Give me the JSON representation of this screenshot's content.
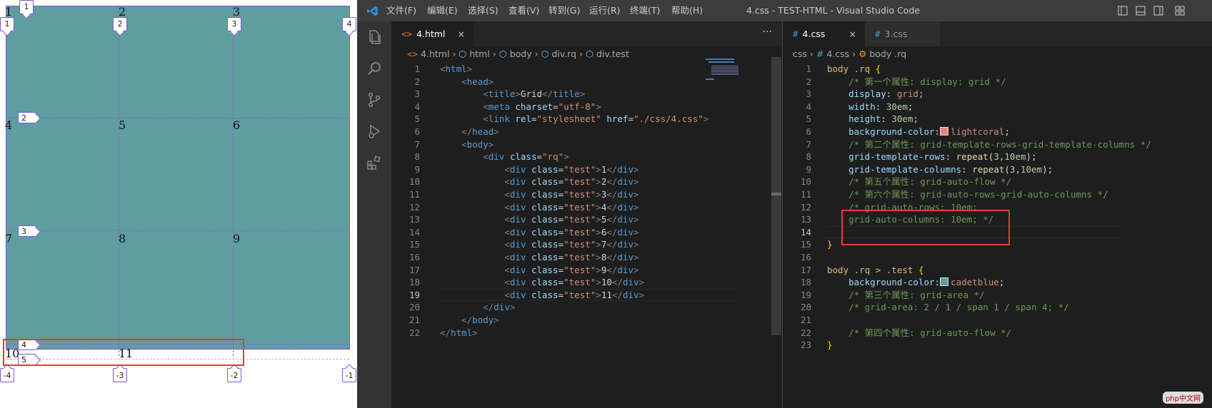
{
  "preview": {
    "cells": [
      "1",
      "2",
      "3",
      "4",
      "5",
      "6",
      "7",
      "8",
      "9",
      "10",
      "11"
    ],
    "line_tags_top": [
      "1",
      "2",
      "3",
      "4"
    ],
    "line_tags_left": [
      "1",
      "2",
      "3",
      "4",
      "5"
    ],
    "line_tags_bottom": [
      "-4",
      "-3",
      "-2",
      "-1"
    ],
    "colors": {
      "grid_bg": "#5f9ea0",
      "grid_lines": "#8a63d2",
      "highlight": "#e53935"
    }
  },
  "titlebar": {
    "menus": [
      "文件(F)",
      "编辑(E)",
      "选择(S)",
      "查看(V)",
      "转到(G)",
      "运行(R)",
      "终端(T)",
      "帮助(H)"
    ],
    "window_title": "4.css - TEST-HTML - Visual Studio Code"
  },
  "activity_icons": [
    "explorer-icon",
    "search-icon",
    "source-control-icon",
    "run-debug-icon",
    "extensions-icon"
  ],
  "left_editor": {
    "tab": {
      "label": "4.html",
      "icon": "<>",
      "close": "×"
    },
    "more": "···",
    "breadcrumb": [
      "4.html",
      "html",
      "body",
      "div.rq",
      "div.test"
    ],
    "current_line": 19,
    "lines": [
      [
        [
          "c-punc",
          "<"
        ],
        [
          "c-tag",
          "html"
        ],
        [
          "c-punc",
          ">"
        ]
      ],
      [
        [
          "c-text",
          "    "
        ],
        [
          "c-punc",
          "<"
        ],
        [
          "c-tag",
          "head"
        ],
        [
          "c-punc",
          ">"
        ]
      ],
      [
        [
          "c-text",
          "        "
        ],
        [
          "c-punc",
          "<"
        ],
        [
          "c-tag",
          "title"
        ],
        [
          "c-punc",
          ">"
        ],
        [
          "c-text",
          "Grid"
        ],
        [
          "c-punc",
          "</"
        ],
        [
          "c-tag",
          "title"
        ],
        [
          "c-punc",
          ">"
        ]
      ],
      [
        [
          "c-text",
          "        "
        ],
        [
          "c-punc",
          "<"
        ],
        [
          "c-tag",
          "meta"
        ],
        [
          "c-text",
          " "
        ],
        [
          "c-attr",
          "charset"
        ],
        [
          "c-text",
          "="
        ],
        [
          "c-str",
          "\"utf-8\""
        ],
        [
          "c-punc",
          ">"
        ]
      ],
      [
        [
          "c-text",
          "        "
        ],
        [
          "c-punc",
          "<"
        ],
        [
          "c-tag",
          "link"
        ],
        [
          "c-text",
          " "
        ],
        [
          "c-attr",
          "rel"
        ],
        [
          "c-text",
          "="
        ],
        [
          "c-str",
          "\"stylesheet\""
        ],
        [
          "c-text",
          " "
        ],
        [
          "c-attr",
          "href"
        ],
        [
          "c-text",
          "="
        ],
        [
          "c-str",
          "\"./css/4.css\""
        ],
        [
          "c-punc",
          ">"
        ]
      ],
      [
        [
          "c-text",
          "    "
        ],
        [
          "c-punc",
          "</"
        ],
        [
          "c-tag",
          "head"
        ],
        [
          "c-punc",
          ">"
        ]
      ],
      [
        [
          "c-text",
          "    "
        ],
        [
          "c-punc",
          "<"
        ],
        [
          "c-tag",
          "body"
        ],
        [
          "c-punc",
          ">"
        ]
      ],
      [
        [
          "c-text",
          "        "
        ],
        [
          "c-punc",
          "<"
        ],
        [
          "c-tag",
          "div"
        ],
        [
          "c-text",
          " "
        ],
        [
          "c-attr",
          "class"
        ],
        [
          "c-text",
          "="
        ],
        [
          "c-str",
          "\"rq\""
        ],
        [
          "c-punc",
          ">"
        ]
      ],
      [
        [
          "c-text",
          "            "
        ],
        [
          "c-punc",
          "<"
        ],
        [
          "c-tag",
          "div"
        ],
        [
          "c-text",
          " "
        ],
        [
          "c-attr",
          "class"
        ],
        [
          "c-text",
          "="
        ],
        [
          "c-str",
          "\"test\""
        ],
        [
          "c-punc",
          ">"
        ],
        [
          "c-text",
          "1"
        ],
        [
          "c-punc",
          "</"
        ],
        [
          "c-tag",
          "div"
        ],
        [
          "c-punc",
          ">"
        ]
      ],
      [
        [
          "c-text",
          "            "
        ],
        [
          "c-punc",
          "<"
        ],
        [
          "c-tag",
          "div"
        ],
        [
          "c-text",
          " "
        ],
        [
          "c-attr",
          "class"
        ],
        [
          "c-text",
          "="
        ],
        [
          "c-str",
          "\"test\""
        ],
        [
          "c-punc",
          ">"
        ],
        [
          "c-text",
          "2"
        ],
        [
          "c-punc",
          "</"
        ],
        [
          "c-tag",
          "div"
        ],
        [
          "c-punc",
          ">"
        ]
      ],
      [
        [
          "c-text",
          "            "
        ],
        [
          "c-punc",
          "<"
        ],
        [
          "c-tag",
          "div"
        ],
        [
          "c-text",
          " "
        ],
        [
          "c-attr",
          "class"
        ],
        [
          "c-text",
          "="
        ],
        [
          "c-str",
          "\"test\""
        ],
        [
          "c-punc",
          ">"
        ],
        [
          "c-text",
          "3"
        ],
        [
          "c-punc",
          "</"
        ],
        [
          "c-tag",
          "div"
        ],
        [
          "c-punc",
          ">"
        ]
      ],
      [
        [
          "c-text",
          "            "
        ],
        [
          "c-punc",
          "<"
        ],
        [
          "c-tag",
          "div"
        ],
        [
          "c-text",
          " "
        ],
        [
          "c-attr",
          "class"
        ],
        [
          "c-text",
          "="
        ],
        [
          "c-str",
          "\"test\""
        ],
        [
          "c-punc",
          ">"
        ],
        [
          "c-text",
          "4"
        ],
        [
          "c-punc",
          "</"
        ],
        [
          "c-tag",
          "div"
        ],
        [
          "c-punc",
          ">"
        ]
      ],
      [
        [
          "c-text",
          "            "
        ],
        [
          "c-punc",
          "<"
        ],
        [
          "c-tag",
          "div"
        ],
        [
          "c-text",
          " "
        ],
        [
          "c-attr",
          "class"
        ],
        [
          "c-text",
          "="
        ],
        [
          "c-str",
          "\"test\""
        ],
        [
          "c-punc",
          ">"
        ],
        [
          "c-text",
          "5"
        ],
        [
          "c-punc",
          "</"
        ],
        [
          "c-tag",
          "div"
        ],
        [
          "c-punc",
          ">"
        ]
      ],
      [
        [
          "c-text",
          "            "
        ],
        [
          "c-punc",
          "<"
        ],
        [
          "c-tag",
          "div"
        ],
        [
          "c-text",
          " "
        ],
        [
          "c-attr",
          "class"
        ],
        [
          "c-text",
          "="
        ],
        [
          "c-str",
          "\"test\""
        ],
        [
          "c-punc",
          ">"
        ],
        [
          "c-text",
          "6"
        ],
        [
          "c-punc",
          "</"
        ],
        [
          "c-tag",
          "div"
        ],
        [
          "c-punc",
          ">"
        ]
      ],
      [
        [
          "c-text",
          "            "
        ],
        [
          "c-punc",
          "<"
        ],
        [
          "c-tag",
          "div"
        ],
        [
          "c-text",
          " "
        ],
        [
          "c-attr",
          "class"
        ],
        [
          "c-text",
          "="
        ],
        [
          "c-str",
          "\"test\""
        ],
        [
          "c-punc",
          ">"
        ],
        [
          "c-text",
          "7"
        ],
        [
          "c-punc",
          "</"
        ],
        [
          "c-tag",
          "div"
        ],
        [
          "c-punc",
          ">"
        ]
      ],
      [
        [
          "c-text",
          "            "
        ],
        [
          "c-punc",
          "<"
        ],
        [
          "c-tag",
          "div"
        ],
        [
          "c-text",
          " "
        ],
        [
          "c-attr",
          "class"
        ],
        [
          "c-text",
          "="
        ],
        [
          "c-str",
          "\"test\""
        ],
        [
          "c-punc",
          ">"
        ],
        [
          "c-text",
          "8"
        ],
        [
          "c-punc",
          "</"
        ],
        [
          "c-tag",
          "div"
        ],
        [
          "c-punc",
          ">"
        ]
      ],
      [
        [
          "c-text",
          "            "
        ],
        [
          "c-punc",
          "<"
        ],
        [
          "c-tag",
          "div"
        ],
        [
          "c-text",
          " "
        ],
        [
          "c-attr",
          "class"
        ],
        [
          "c-text",
          "="
        ],
        [
          "c-str",
          "\"test\""
        ],
        [
          "c-punc",
          ">"
        ],
        [
          "c-text",
          "9"
        ],
        [
          "c-punc",
          "</"
        ],
        [
          "c-tag",
          "div"
        ],
        [
          "c-punc",
          ">"
        ]
      ],
      [
        [
          "c-text",
          "            "
        ],
        [
          "c-punc",
          "<"
        ],
        [
          "c-tag",
          "div"
        ],
        [
          "c-text",
          " "
        ],
        [
          "c-attr",
          "class"
        ],
        [
          "c-text",
          "="
        ],
        [
          "c-str",
          "\"test\""
        ],
        [
          "c-punc",
          ">"
        ],
        [
          "c-text",
          "10"
        ],
        [
          "c-punc",
          "</"
        ],
        [
          "c-tag",
          "div"
        ],
        [
          "c-punc",
          ">"
        ]
      ],
      [
        [
          "c-text",
          "            "
        ],
        [
          "c-punc",
          "<"
        ],
        [
          "c-tag",
          "div"
        ],
        [
          "c-text",
          " "
        ],
        [
          "c-attr",
          "class"
        ],
        [
          "c-text",
          "="
        ],
        [
          "c-str",
          "\"test\""
        ],
        [
          "c-punc",
          ">"
        ],
        [
          "c-text",
          "11"
        ],
        [
          "c-punc",
          "</"
        ],
        [
          "c-tag",
          "div"
        ],
        [
          "c-punc",
          ">"
        ]
      ],
      [
        [
          "c-text",
          "        "
        ],
        [
          "c-punc",
          "</"
        ],
        [
          "c-tag",
          "div"
        ],
        [
          "c-punc",
          ">"
        ]
      ],
      [
        [
          "c-text",
          "    "
        ],
        [
          "c-punc",
          "</"
        ],
        [
          "c-tag",
          "body"
        ],
        [
          "c-punc",
          ">"
        ]
      ],
      [
        [
          "c-punc",
          "</"
        ],
        [
          "c-tag",
          "html"
        ],
        [
          "c-punc",
          ">"
        ]
      ]
    ]
  },
  "right_editor": {
    "tabs": [
      {
        "label": "4.css",
        "icon": "#",
        "close": "×",
        "active": true
      },
      {
        "label": "3.css",
        "icon": "#",
        "active": false
      }
    ],
    "breadcrumb": [
      "css",
      "4.css",
      "body .rq"
    ],
    "current_line": 14,
    "lines": [
      [
        [
          "c-sel",
          "body .rq "
        ],
        [
          "c-brace",
          "{"
        ]
      ],
      [
        [
          "c-text",
          "    "
        ],
        [
          "c-com",
          "/* 第一个属性: display: grid */"
        ]
      ],
      [
        [
          "c-text",
          "    "
        ],
        [
          "c-prop",
          "display"
        ],
        [
          "c-text",
          ": "
        ],
        [
          "c-val",
          "grid"
        ],
        [
          "c-text",
          ";"
        ]
      ],
      [
        [
          "c-text",
          "    "
        ],
        [
          "c-prop",
          "width"
        ],
        [
          "c-text",
          ": "
        ],
        [
          "c-num",
          "30em"
        ],
        [
          "c-text",
          ";"
        ]
      ],
      [
        [
          "c-text",
          "    "
        ],
        [
          "c-prop",
          "height"
        ],
        [
          "c-text",
          ": "
        ],
        [
          "c-num",
          "30em"
        ],
        [
          "c-text",
          ";"
        ]
      ],
      [
        [
          "c-text",
          "    "
        ],
        [
          "c-prop",
          "background-color"
        ],
        [
          "c-text",
          ":"
        ],
        [
          "swatch",
          "#f08080"
        ],
        [
          "c-val",
          "lightcoral"
        ],
        [
          "c-text",
          ";"
        ]
      ],
      [
        [
          "c-text",
          "    "
        ],
        [
          "c-com",
          "/* 第二个属性: grid-template-rows-grid-template-columns */"
        ]
      ],
      [
        [
          "c-text",
          "    "
        ],
        [
          "c-prop",
          "grid-template-rows"
        ],
        [
          "c-text",
          ": "
        ],
        [
          "c-fn",
          "repeat"
        ],
        [
          "c-text",
          "("
        ],
        [
          "c-num",
          "3"
        ],
        [
          "c-text",
          ","
        ],
        [
          "c-num",
          "10em"
        ],
        [
          "c-text",
          ");"
        ]
      ],
      [
        [
          "c-text",
          "    "
        ],
        [
          "c-prop",
          "grid-template-columns"
        ],
        [
          "c-text",
          ": "
        ],
        [
          "c-fn",
          "repeat"
        ],
        [
          "c-text",
          "("
        ],
        [
          "c-num",
          "3"
        ],
        [
          "c-text",
          ","
        ],
        [
          "c-num",
          "10em"
        ],
        [
          "c-text",
          ");"
        ]
      ],
      [
        [
          "c-text",
          "    "
        ],
        [
          "c-com",
          "/* 第五个属性: grid-auto-flow */"
        ]
      ],
      [
        [
          "c-text",
          "    "
        ],
        [
          "c-com",
          "/* 第六个属性: grid-auto-rows-grid-auto-columns */"
        ]
      ],
      [
        [
          "c-text",
          "    "
        ],
        [
          "c-com",
          "/* grid-auto-rows: 10em;"
        ]
      ],
      [
        [
          "c-text",
          "    "
        ],
        [
          "c-com",
          "grid-auto-columns: 10em; */"
        ]
      ],
      [
        [
          "c-text",
          ""
        ]
      ],
      [
        [
          "c-brace",
          "}"
        ]
      ],
      [
        [
          "c-text",
          ""
        ]
      ],
      [
        [
          "c-sel",
          "body .rq > .test "
        ],
        [
          "c-brace",
          "{"
        ]
      ],
      [
        [
          "c-text",
          "    "
        ],
        [
          "c-prop",
          "background-color"
        ],
        [
          "c-text",
          ":"
        ],
        [
          "swatch",
          "#5f9ea0"
        ],
        [
          "c-val",
          "cadetblue"
        ],
        [
          "c-text",
          ";"
        ]
      ],
      [
        [
          "c-text",
          "    "
        ],
        [
          "c-com",
          "/* 第三个属性: grid-area */"
        ]
      ],
      [
        [
          "c-text",
          "    "
        ],
        [
          "c-com",
          "/* grid-area: 2 / 1 / span 1 / span 4; */"
        ]
      ],
      [
        [
          "c-text",
          ""
        ]
      ],
      [
        [
          "c-text",
          "    "
        ],
        [
          "c-com",
          "/* 第四个属性: grid-auto-flow */"
        ]
      ],
      [
        [
          "c-brace",
          "}"
        ]
      ]
    ]
  },
  "watermark": "php中文网"
}
